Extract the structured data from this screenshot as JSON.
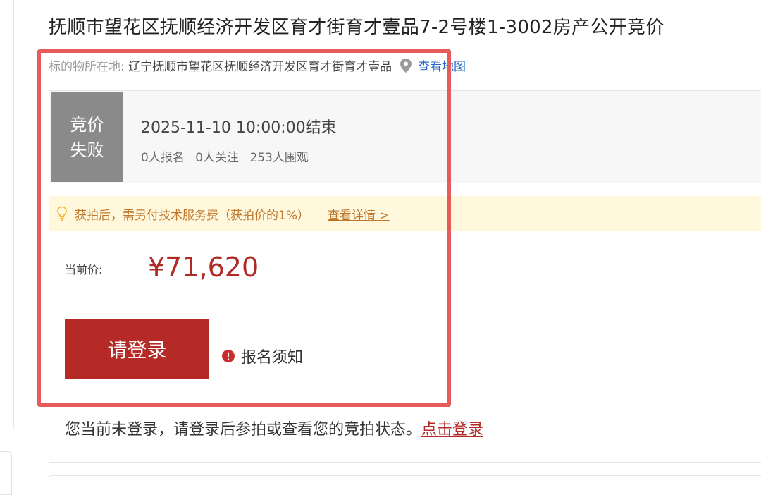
{
  "title": "抚顺市望花区抚顺经济开发区育才街育才壹品7-2号楼1-3002房产公开竞价",
  "location": {
    "label": "标的物所在地:",
    "value": "辽宁抚顺市望花区抚顺经济开发区育才街育才壹品",
    "pin_icon": "map-pin-icon",
    "map_link": "查看地图"
  },
  "status": {
    "badge_line1": "竞价",
    "badge_line2": "失败",
    "end_time": "2025-11-10 10:00:00结束",
    "signups": "0人报名",
    "followers": "0人关注",
    "viewers": "253人围观"
  },
  "notice": {
    "icon": "lightbulb-icon",
    "text": "获拍后，需另付技术服务费（获拍价的1%）",
    "link": "查看详情 >"
  },
  "price": {
    "label": "当前价:",
    "value": "¥71,620"
  },
  "actions": {
    "login_button": "请登录",
    "registration_notice": "报名须知",
    "warn_icon": "exclamation-circle-icon"
  },
  "login_hint": {
    "text": "您当前未登录，请登录后参拍或查看您的竞拍状态。",
    "link": "点击登录"
  },
  "colors": {
    "accent_red": "#b52a26",
    "status_gray": "#8a8a8a",
    "notice_bg": "#fff8dc",
    "link_blue": "#1f63c8",
    "highlight": "#e85b5b"
  }
}
